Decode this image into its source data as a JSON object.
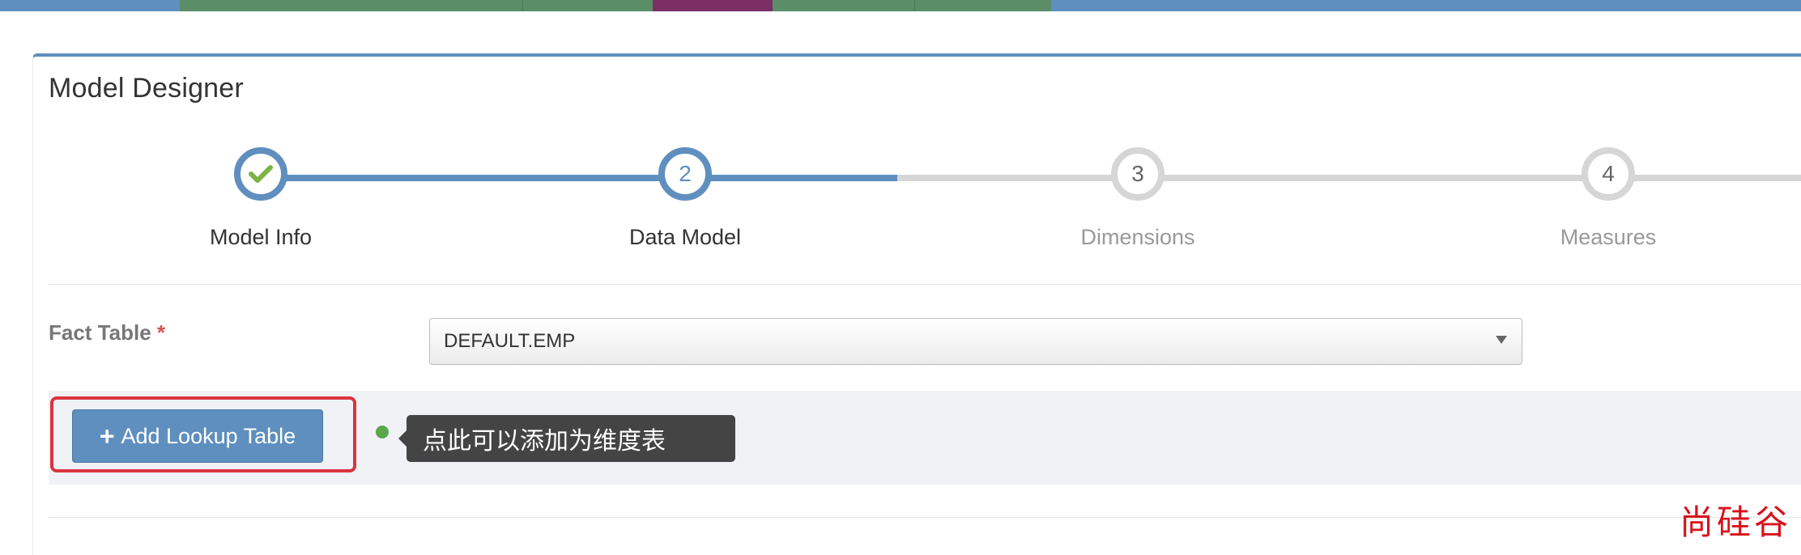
{
  "colors": {
    "accent": "#5f8fbf",
    "step_inactive": "#d6d6d6",
    "check_green": "#7cb342",
    "required_red": "#d9534f",
    "highlight_red": "#d9343f",
    "tooltip_bg": "#444444",
    "band_bg": "#f0f2f6",
    "top_strip": [
      "#5f8fbf",
      "#5b8e67",
      "#5b8e67",
      "#7b2f64",
      "#5b8e67",
      "#5b8e67",
      "#5f8fbf"
    ]
  },
  "page": {
    "title": "Model Designer"
  },
  "wizard": {
    "steps": [
      {
        "label": "Model Info",
        "number": "",
        "state": "done",
        "icon": "check-icon"
      },
      {
        "label": "Data Model",
        "number": "2",
        "state": "active"
      },
      {
        "label": "Dimensions",
        "number": "3",
        "state": "inactive"
      },
      {
        "label": "Measures",
        "number": "4",
        "state": "inactive"
      }
    ]
  },
  "form": {
    "fact_table_label": "Fact Table",
    "required_marker": "*",
    "fact_table_value": "DEFAULT.EMP"
  },
  "lookup": {
    "add_button_label": "Add Lookup Table",
    "add_button_icon": "plus-icon",
    "tooltip_text": "点此可以添加为维度表"
  },
  "watermark": {
    "text": "尚硅谷"
  }
}
